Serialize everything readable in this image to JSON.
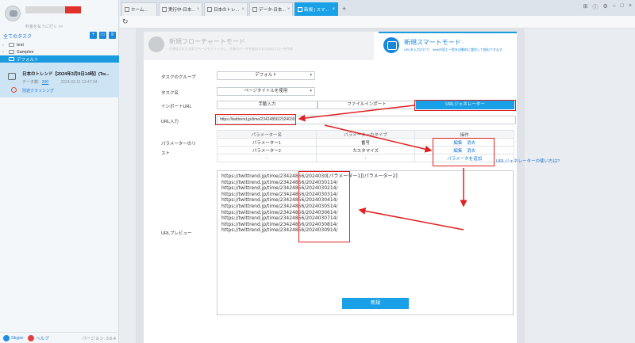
{
  "sidebar": {
    "user_sub": "料金を払うに行く >>",
    "all_tasks": "全てのタスク",
    "tree": [
      {
        "label": "test"
      },
      {
        "label": "Samples"
      },
      {
        "label": "デフォルト"
      }
    ],
    "task": {
      "title": "日本のトレンド【2024年3月9日14時】(Tw...",
      "count_label": "データ数:",
      "count": "200",
      "time": "2024-03-11 13:47:34",
      "start": "別途クラッシング"
    },
    "footer": {
      "skype": "Skype",
      "help": "ヘルプ",
      "version": "バージョン: 3.6.4"
    }
  },
  "tabs": [
    {
      "label": "ホーム..."
    },
    {
      "label": "実行中-日本..."
    },
    {
      "label": "日本のトレ..."
    },
    {
      "label": "データ-日本..."
    },
    {
      "label": "新規 | スマ..."
    }
  ],
  "modes": {
    "flow_title": "新規フローチャートモード",
    "flow_sub": "可視化された方式でページをクリックし、任意のデータを抽出するためのフローを作成",
    "smart_title": "新規スマートモード",
    "smart_sub": "URLを入力だけで、Web内容と一覧を自動的に識別して抽出できます"
  },
  "form": {
    "group_label": "タスクのグループ",
    "group_value": "デフォルト",
    "name_label": "タスク名",
    "name_value": "ページタイトルを使用",
    "import_label": "インポートURL",
    "import_options": [
      "手動入力",
      "ファイルインポート",
      "URLジェネレーター"
    ],
    "url_label": "URL入力",
    "url_value": "https://twittrend.jp/time/23424856/2024030",
    "param_label_1": "パラメーターのリ",
    "param_label_2": "スト",
    "table": {
      "headers": [
        "パラメーター名",
        "パラメーターのタイプ",
        "操作"
      ],
      "rows": [
        {
          "name": "パラメーター1",
          "type": "番号",
          "ops": [
            "編集",
            "消去"
          ]
        },
        {
          "name": "パラメーター2",
          "type": "カスタマイズ",
          "ops": [
            "編集",
            "消去"
          ]
        },
        {
          "name": "-",
          "type": "-",
          "ops": [
            "パラメータを追加"
          ]
        }
      ]
    },
    "helper_link": "URLジェネレーターの使い方は?",
    "preview_label": "URLプレビュー",
    "preview_lines": [
      "https://twittrend.jp/time/23424856/2024030[パラメーター1][パラメーター2]",
      "https://twittrend.jp/time/23424856/2024030114/",
      "https://twittrend.jp/time/23424856/2024030214/",
      "https://twittrend.jp/time/23424856/2024030314/",
      "https://twittrend.jp/time/23424856/2024030414/",
      "https://twittrend.jp/time/23424856/2024030514/",
      "https://twittrend.jp/time/23424856/2024030614/",
      "https://twittrend.jp/time/23424856/2024030714/",
      "https://twittrend.jp/time/23424856/2024030814/",
      "https://twittrend.jp/time/23424856/2024030914/"
    ],
    "save_label": "新規"
  },
  "colors": {
    "accent": "#1aa0e6",
    "highlight": "#e02020"
  }
}
